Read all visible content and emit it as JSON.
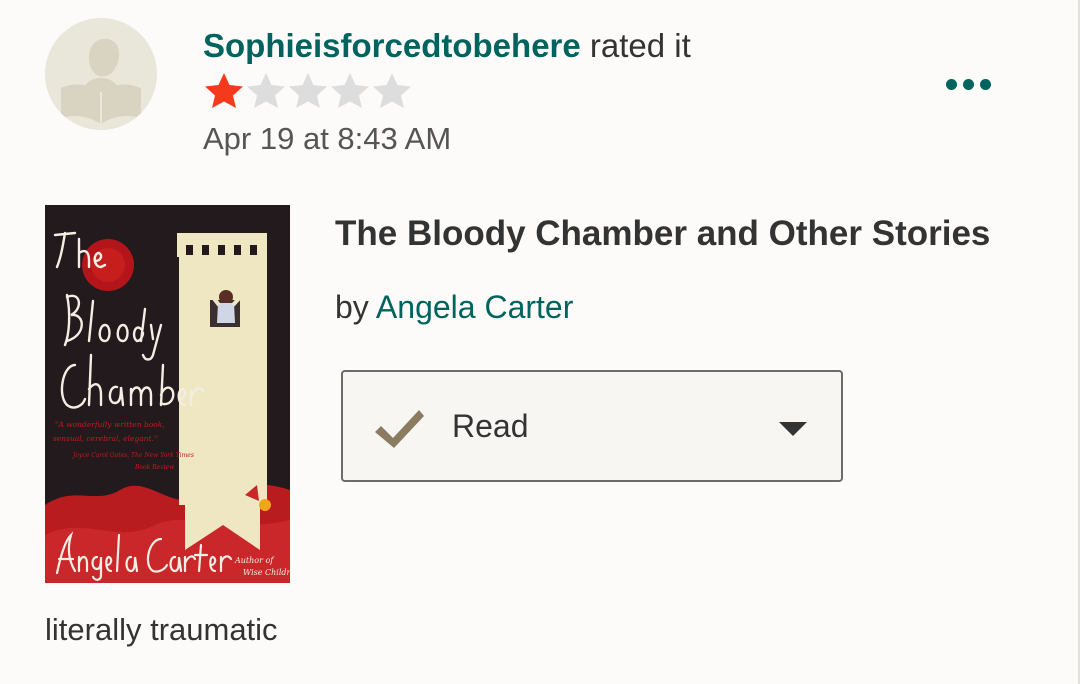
{
  "activity": {
    "username": "Sophieisforcedtobehere",
    "action": "rated it",
    "rating": 1,
    "max_rating": 5,
    "timestamp": "Apr 19 at 8:43 AM",
    "more_icon": "more-dots-icon"
  },
  "book": {
    "title": "The Bloody Chamber and Other Stories",
    "by_prefix": "by",
    "author": "Angela Carter",
    "cover": {
      "title_lines": [
        "The",
        "Bloody",
        "Chamber"
      ],
      "quote_lines": [
        "\"A wonderfully written book,",
        "sensual, cerebral, elegant.\"",
        "— Joyce Carol Oates, The New York Times",
        "Book Review"
      ],
      "author": "Angela Carter",
      "subtitle": "Author of Wise Children"
    }
  },
  "shelf": {
    "label": "Read",
    "icon": "checkmark-icon",
    "dropdown_icon": "caret-down-icon"
  },
  "review": {
    "text": "literally traumatic"
  },
  "colors": {
    "brand": "#00635d",
    "star_filled": "#f4391c",
    "star_empty": "#dddddd",
    "check": "#8b7b60"
  }
}
